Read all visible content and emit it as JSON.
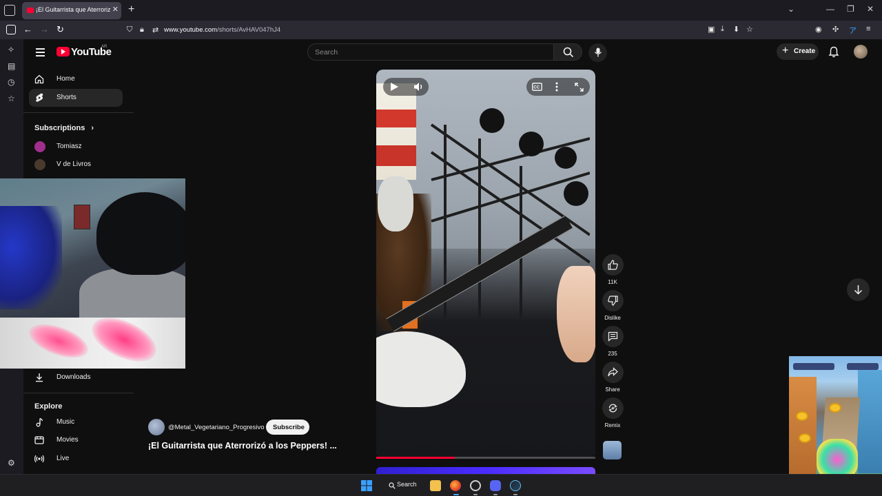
{
  "browser": {
    "tab_title": "¡El Guitarrista que Aterrorizó a l",
    "new_tab": "+",
    "tab_close": "✕",
    "url_host": "www.youtube.com",
    "url_path": "/shorts/AvHAV047hJ4"
  },
  "yt": {
    "logo_text": "YouTube",
    "logo_country": "AR",
    "search_placeholder": "Search",
    "create_label": "Create"
  },
  "sidebar": {
    "home": "Home",
    "shorts": "Shorts",
    "subscriptions_heading": "Subscriptions",
    "channels": [
      "Tomiasz",
      "V de Livros"
    ],
    "downloads": "Downloads",
    "explore_heading": "Explore",
    "explore_items": [
      "Music",
      "Movies",
      "Live"
    ]
  },
  "video": {
    "channel": "@Metal_Vegetariano_Progresivo",
    "subscribe": "Subscribe",
    "title": "¡El Guitarrista que Aterrorizó a los Peppers! ...",
    "progress_fraction": 0.36
  },
  "actions": {
    "likes": "11K",
    "dislike": "Dislike",
    "comments": "235",
    "share": "Share",
    "remix": "Remix"
  },
  "taskbar": {
    "search_label": "Search"
  },
  "colors": {
    "background": "#0f0f0f",
    "yt_red": "#ff0033",
    "chip": "#272727"
  }
}
